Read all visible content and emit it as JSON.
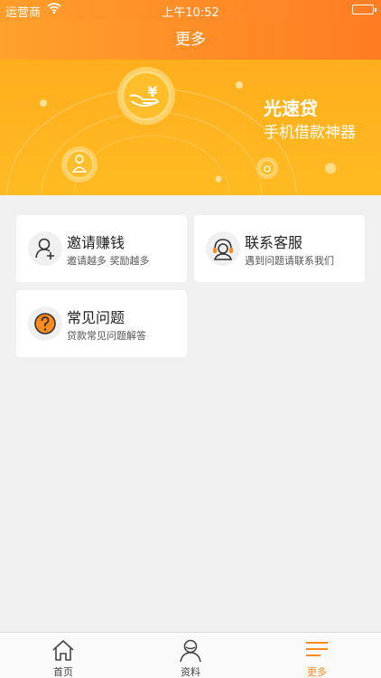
{
  "status_bar": {
    "carrier": "运营商",
    "time": "上午10:52"
  },
  "header": {
    "title": "更多"
  },
  "banner": {
    "title": "光速贷",
    "subtitle": "手机借款神器"
  },
  "cards": [
    {
      "title": "邀请赚钱",
      "desc": "邀请越多 奖励越多",
      "icon": "invite-user-icon"
    },
    {
      "title": "联系客服",
      "desc": "遇到问题请联系我们",
      "icon": "customer-service-icon"
    },
    {
      "title": "常见问题",
      "desc": "贷款常见问题解答",
      "icon": "question-icon"
    }
  ],
  "tabs": [
    {
      "label": "首页",
      "icon": "home-icon"
    },
    {
      "label": "资料",
      "icon": "profile-icon"
    },
    {
      "label": "更多",
      "icon": "menu-icon",
      "active": true
    }
  ],
  "colors": {
    "accent": "#ff8a1e",
    "banner": "#ffb31f"
  }
}
